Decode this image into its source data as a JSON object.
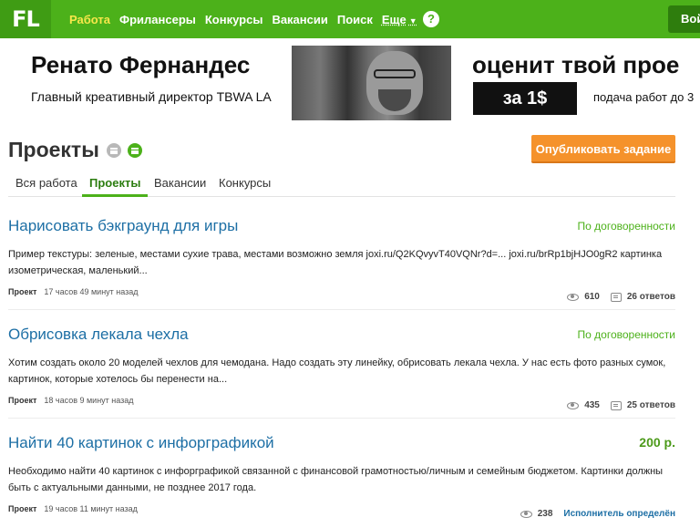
{
  "nav": {
    "logo": "FL",
    "links": [
      "Работа",
      "Фрилансеры",
      "Конкурсы",
      "Вакансии",
      "Поиск"
    ],
    "more": "Еще",
    "help": "?",
    "login": "Вой"
  },
  "banner": {
    "name": "Ренато Фернандес",
    "role": "Главный креативный директор TBWA LA",
    "headline": "оценит твой прое",
    "price": "за 1$",
    "deadline": "подача работ до 3"
  },
  "page": {
    "title": "Проекты",
    "publish_button": "Опубликовать задание",
    "tabs": [
      "Вся работа",
      "Проекты",
      "Вакансии",
      "Конкурсы"
    ]
  },
  "projects": [
    {
      "title": "Нарисовать бэкграунд для игры",
      "budget": "По договоренности",
      "description": "Пример текстуры: зеленые, местами сухие трава, местами возможно земля  joxi.ru/Q2KQvyvT40VQNr?d=...  joxi.ru/brRp1bjHJO0gR2  картинка изометрическая, маленький...",
      "type": "Проект",
      "time": "17 часов 49 минут назад",
      "views": "610",
      "answers": "26 ответов"
    },
    {
      "title": "Обрисовка лекала чехла",
      "budget": "По договоренности",
      "description": "Хотим создать около 20 моделей чехлов для чемодана. Надо создать эту линейку, обрисовать лекала чехла. У нас есть фото разных сумок, картинок, которые хотелось бы перенести на...",
      "type": "Проект",
      "time": "18 часов 9 минут назад",
      "views": "435",
      "answers": "25 ответов"
    },
    {
      "title": "Найти 40 картинок с инфорграфикой",
      "budget": "200 р.",
      "description": "Необходимо найти 40 картинок с инфорграфикой связанной с финансовой грамотностью/личным и семейным бюджетом. Картинки должны быть с актуальными данными, не позднее 2017 года.",
      "type": "Проект",
      "time": "19 часов 11 минут назад",
      "views": "238",
      "executor": "Исполнитель определён"
    }
  ]
}
